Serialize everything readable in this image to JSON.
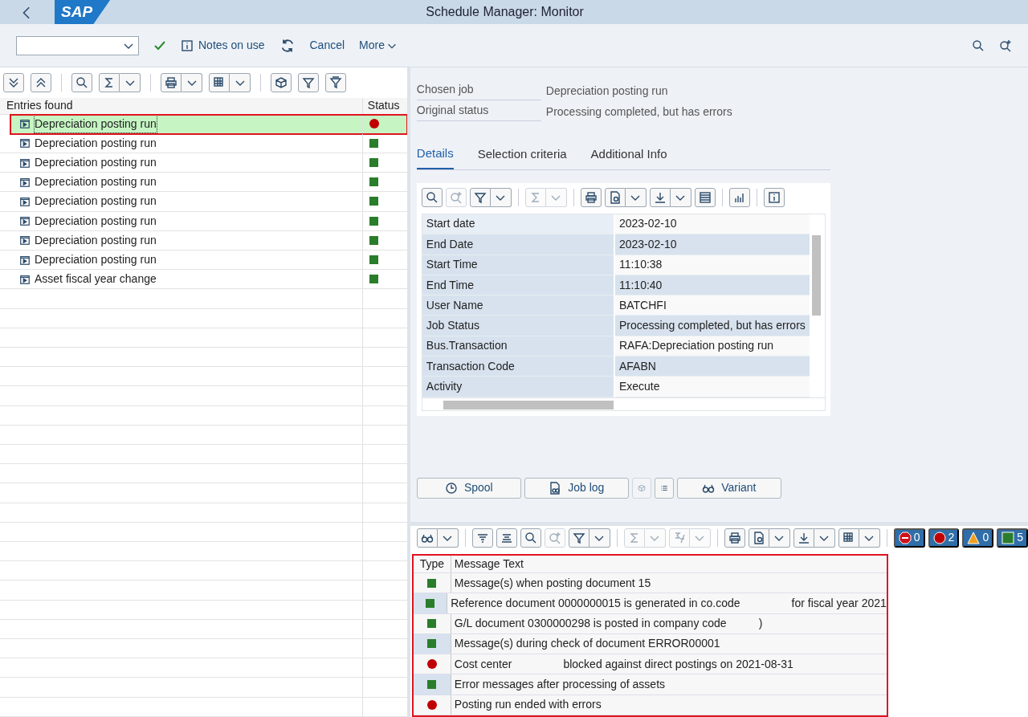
{
  "window": {
    "title": "Schedule Manager: Monitor",
    "logo": "SAP"
  },
  "toolbar": {
    "items": [
      {
        "kind": "dropdown"
      },
      {
        "kind": "check"
      },
      {
        "kind": "info",
        "label": "Notes on use"
      },
      {
        "kind": "refresh"
      },
      {
        "kind": "text",
        "label": "Cancel"
      },
      {
        "kind": "more",
        "label": "More"
      }
    ]
  },
  "jobs": {
    "columns": [
      "Entries found",
      "Status"
    ],
    "rows": [
      {
        "name": "Depreciation posting run",
        "kind": "error",
        "selected": true
      },
      {
        "name": "Depreciation posting run",
        "kind": "success",
        "selected": false
      },
      {
        "name": "Depreciation posting run",
        "kind": "success",
        "selected": false
      },
      {
        "name": "Depreciation posting run",
        "kind": "success",
        "selected": false
      },
      {
        "name": "Depreciation posting run",
        "kind": "success",
        "selected": false
      },
      {
        "name": "Depreciation posting run",
        "kind": "success",
        "selected": false
      },
      {
        "name": "Depreciation posting run",
        "kind": "success",
        "selected": false
      },
      {
        "name": "Depreciation posting run",
        "kind": "success",
        "selected": false
      },
      {
        "name": "Asset fiscal year change",
        "kind": "success",
        "selected": false
      }
    ]
  },
  "summary": [
    {
      "label": "Chosen job",
      "value": "Depreciation posting run"
    },
    {
      "label": "Original status",
      "value": "Processing completed, but has errors"
    }
  ],
  "tabs": [
    {
      "label": "Details",
      "selected": true
    },
    {
      "label": "Selection criteria",
      "selected": false
    },
    {
      "label": "Additional Info",
      "selected": false
    }
  ],
  "details": [
    {
      "label": "Start date",
      "value": "2023-02-10"
    },
    {
      "label": "End Date",
      "value": "2023-02-10"
    },
    {
      "label": "Start Time",
      "value": "11:10:38"
    },
    {
      "label": "End Time",
      "value": "11:10:40"
    },
    {
      "label": "User Name",
      "value": "BATCHFI"
    },
    {
      "label": "Job Status",
      "value": "Processing completed, but has errors"
    },
    {
      "label": "Bus.Transaction",
      "value": "RAFA:Depreciation posting run"
    },
    {
      "label": "Transaction Code",
      "value": "AFABN"
    },
    {
      "label": "Activity",
      "value": "Execute"
    }
  ],
  "actions": [
    {
      "kind": "spool",
      "label": "Spool"
    },
    {
      "kind": "joblog",
      "label": "Job log"
    },
    {
      "kind": "icon-disabled"
    },
    {
      "kind": "list"
    },
    {
      "kind": "variant",
      "label": "Variant"
    }
  ],
  "counters": [
    {
      "kind": "stop",
      "count": "0"
    },
    {
      "kind": "error",
      "count": "2"
    },
    {
      "kind": "warning",
      "count": "0"
    },
    {
      "kind": "success",
      "count": "5"
    }
  ],
  "messages": {
    "columns": [
      "Type",
      "Message Text"
    ],
    "rows": [
      {
        "kind": "success",
        "parts": [
          "Message(s) when posting document 15"
        ]
      },
      {
        "kind": "success",
        "parts": [
          "Reference document 0000000015 is generated in co.code",
          "for fiscal year 2021"
        ]
      },
      {
        "kind": "success",
        "parts": [
          "G/L document 0300000298 is posted in company code",
          ")"
        ]
      },
      {
        "kind": "success",
        "parts": [
          "Message(s) during check of document ERROR00001"
        ]
      },
      {
        "kind": "error",
        "parts": [
          "Cost center",
          "blocked against direct postings on 2021-08-31"
        ]
      },
      {
        "kind": "success",
        "parts": [
          "Error messages after processing of assets"
        ]
      },
      {
        "kind": "error",
        "parts": [
          "Posting run ended with errors"
        ]
      }
    ]
  }
}
